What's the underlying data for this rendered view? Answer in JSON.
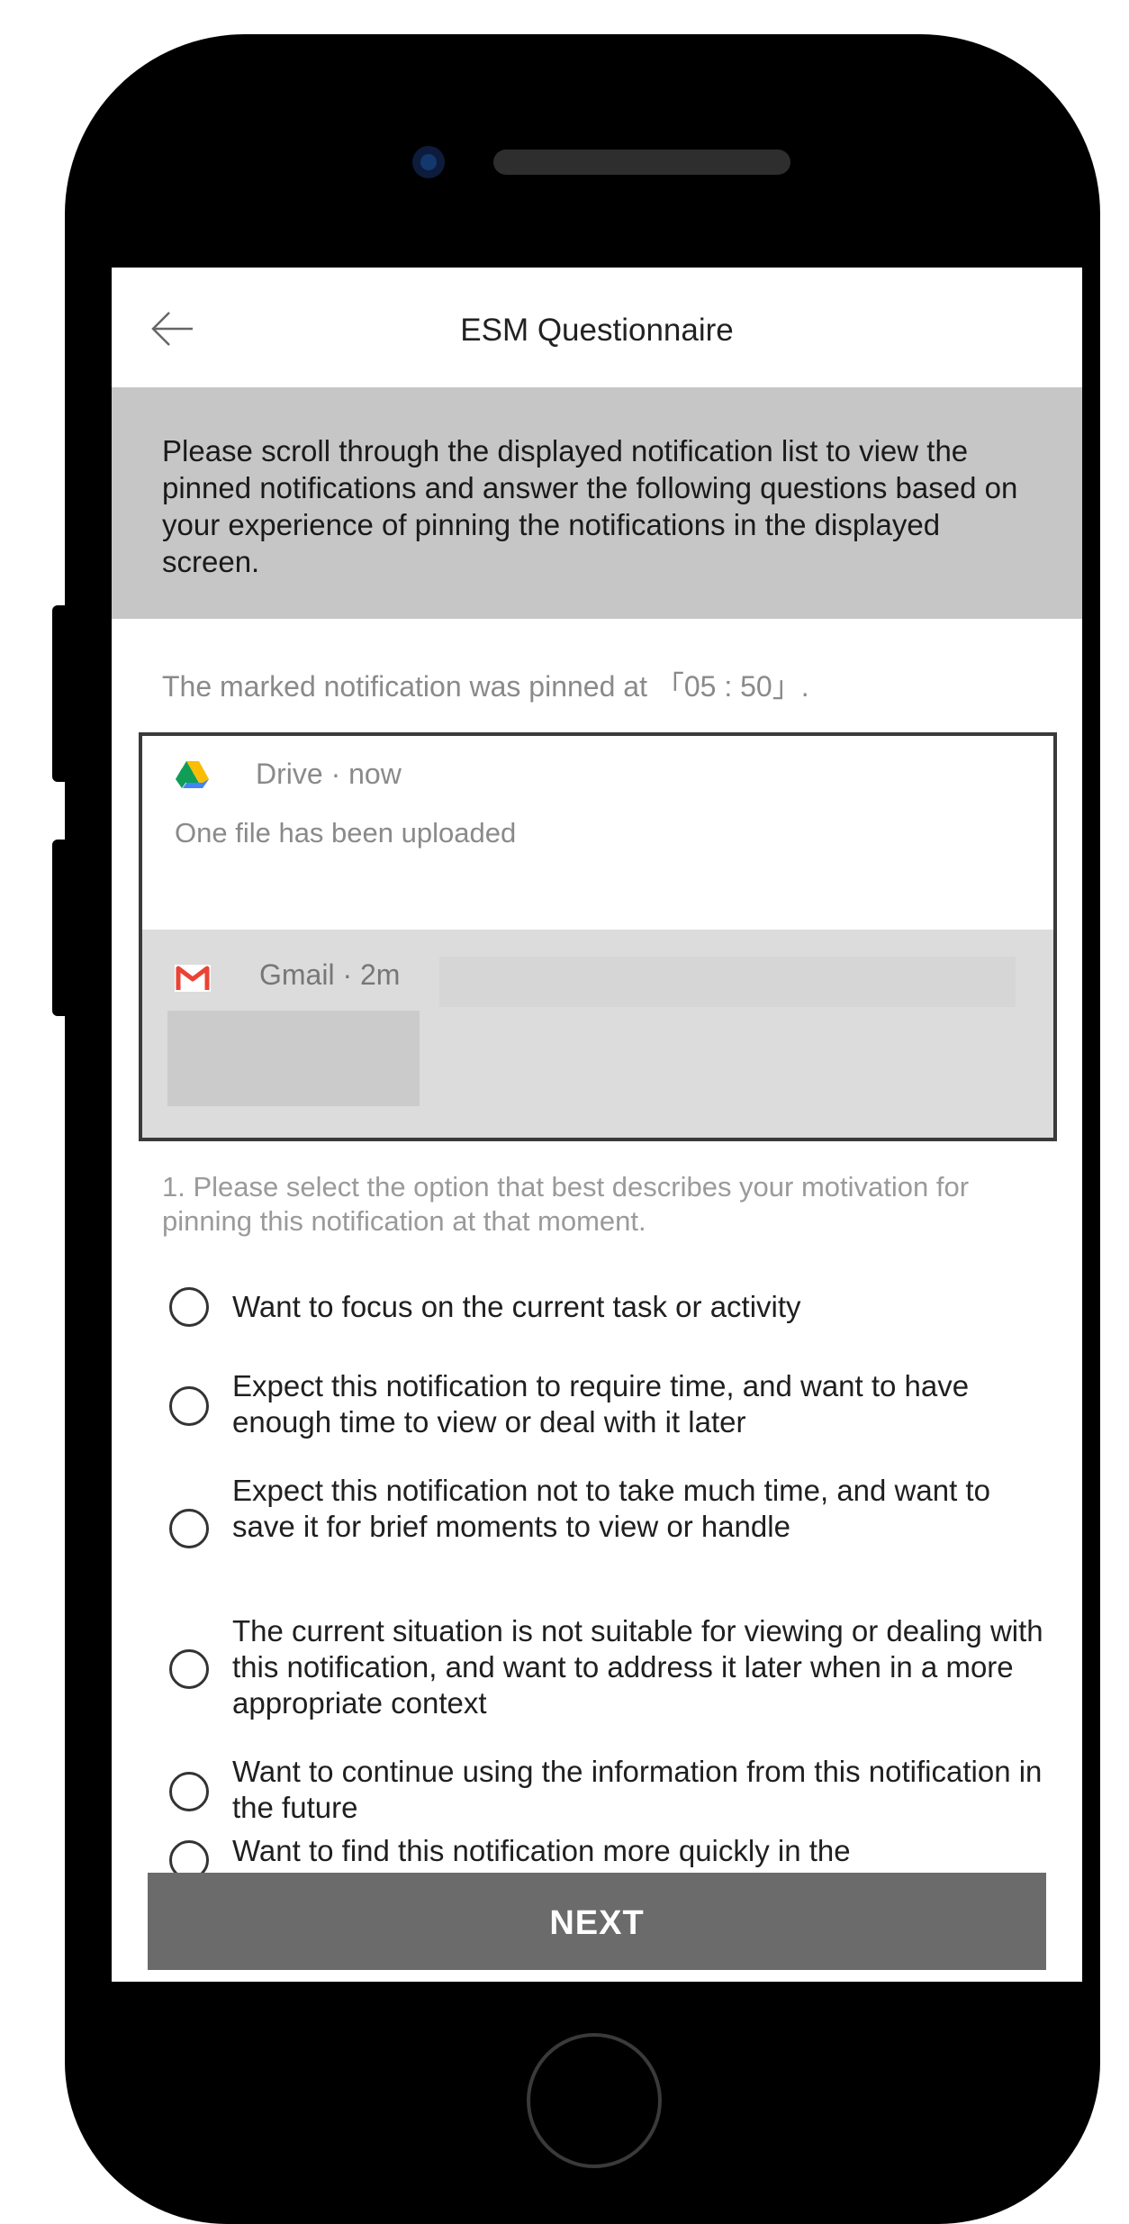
{
  "app": {
    "title": "ESM Questionnaire",
    "back_icon": "arrow-left-icon"
  },
  "instructions": "Please scroll through the displayed notification list to view the pinned notifications and answer the following questions based on your experience of pinning the notifications in the displayed screen.",
  "pinned_time": "The marked notification was pinned at 「05 : 50」.",
  "notifications": [
    {
      "app": "Drive",
      "time": "now",
      "header": "Drive · now",
      "body": "One file has been uploaded",
      "icon": "google-drive-icon"
    },
    {
      "app": "Gmail",
      "time": "2m",
      "header": "Gmail · 2m",
      "icon": "gmail-icon"
    }
  ],
  "question": {
    "number": "1.",
    "text": "1. Please select the option that best describes your motivation for pinning this notification at that moment."
  },
  "options": [
    "Want to focus on the current task or activity",
    "Expect this notification to require time, and want to have enough time to view or deal with it later",
    "Expect this notification not to take much time, and want to save it for brief moments to view or handle",
    "The current situation is not suitable for viewing or dealing with this notification, and want to address it later when in a more appropriate context",
    "Want to continue using the information from this notification in the future",
    "Want to find this notification more quickly in the"
  ],
  "next_label": "NEXT",
  "colors": {
    "instructions_bg": "#c6c6c6",
    "next_button_bg": "#6b6b6b",
    "gmail_row_bg": "#dcdcdc",
    "phone_body": "#000000"
  }
}
